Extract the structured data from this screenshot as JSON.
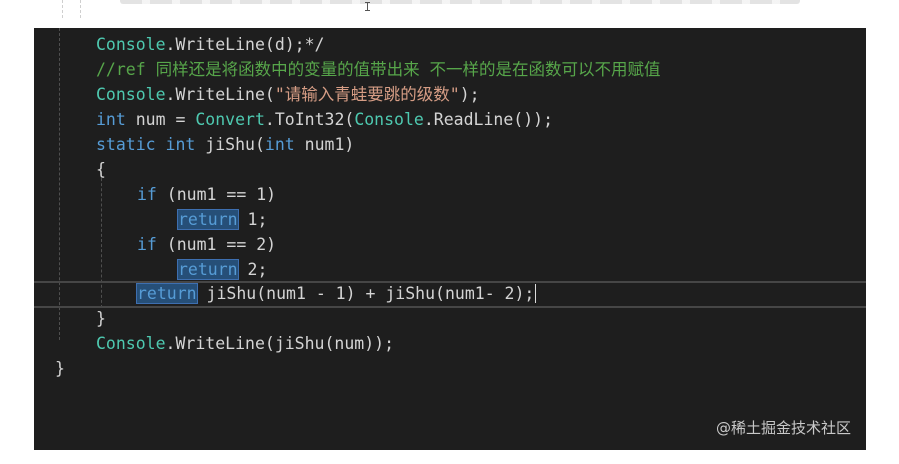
{
  "colors": {
    "editor_background": "#1e1e1e",
    "keyword": "#569cd6",
    "comment": "#57a64a",
    "string": "#d69d85",
    "type": "#4ec9b0",
    "plain": "#d4d4d4",
    "highlight": "#264f78"
  },
  "code": {
    "line1": {
      "type": "Console",
      "rest": ".WriteLine(d);*/"
    },
    "line2": {
      "comment": "//ref 同样还是将函数中的变量的值带出来 不一样的是在函数可以不用赋值"
    },
    "line3": {
      "type": "Console",
      "method": ".WriteLine(",
      "string": "\"请输入青蛙要跳的级数\"",
      "end": ");"
    },
    "line4": {
      "kw_int": "int",
      "mid": " num = ",
      "type_convert": "Convert",
      "mid2": ".ToInt32(",
      "type_console": "Console",
      "end": ".ReadLine());"
    },
    "line5": {
      "kw_static": "static",
      "kw_int": "int",
      "name": " jiShu(",
      "kw_int2": "int",
      "end": " num1)"
    },
    "line6": {
      "text": "{"
    },
    "line7": {
      "kw_if": "if",
      "end": " (num1 == 1)"
    },
    "line8": {
      "kw_return": "return",
      "end": " 1;"
    },
    "line9": {
      "kw_if": "if",
      "end": " (num1 == 2)"
    },
    "line10": {
      "kw_return": "return",
      "end": " 2;"
    },
    "line11": {
      "kw_return": "return",
      "end": " jiShu(num1 - 1) + jiShu(num1- 2);"
    },
    "line12": {
      "text": "}"
    },
    "line13": {
      "type": "Console",
      "rest": ".WriteLine(jiShu(num));"
    },
    "line14": {
      "text": "}"
    }
  },
  "watermark": "@稀土掘金技术社区"
}
